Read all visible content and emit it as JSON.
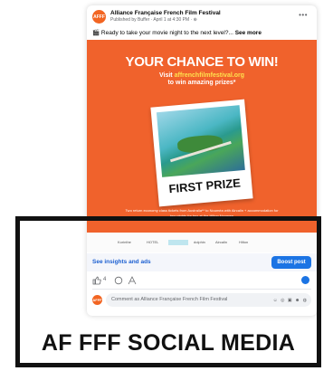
{
  "post": {
    "page_name": "Alliance Française French Film Festival",
    "meta": "Published by Buffer · April 1 at 4:30 PM · ⊕",
    "avatar_text": "AFFF",
    "text": "🎬 Ready to take your movie night to the next level?...",
    "see_more": "See more",
    "more_icon": "more-dots-icon"
  },
  "hero": {
    "title": "YOUR CHANCE TO WIN!",
    "line1_prefix": "Visit ",
    "link": "affrenchfilmfestival.org",
    "line2": "to win amazing prizes*",
    "photo_label": "FIRST PRIZE",
    "fine_print": "Two return economy class tickets from Australia** to Nouméa with Aircalin + accommodation for two nights for two at the Hilton Noumea",
    "background": "#f0622c"
  },
  "sponsors": [
    "Korinthe",
    "HOTEL",
    "Aircalin",
    "dolphin",
    "Aircalin",
    "Hilton"
  ],
  "actions": {
    "insights": "See insights and ads",
    "boost": "Boost post",
    "like_count": "4"
  },
  "comment": {
    "placeholder": "Comment as Alliance Française French Film Festival"
  },
  "caption": "AF FFF SOCIAL MEDIA",
  "colors": {
    "accent": "#1b74e4",
    "brand": "#f26522"
  }
}
